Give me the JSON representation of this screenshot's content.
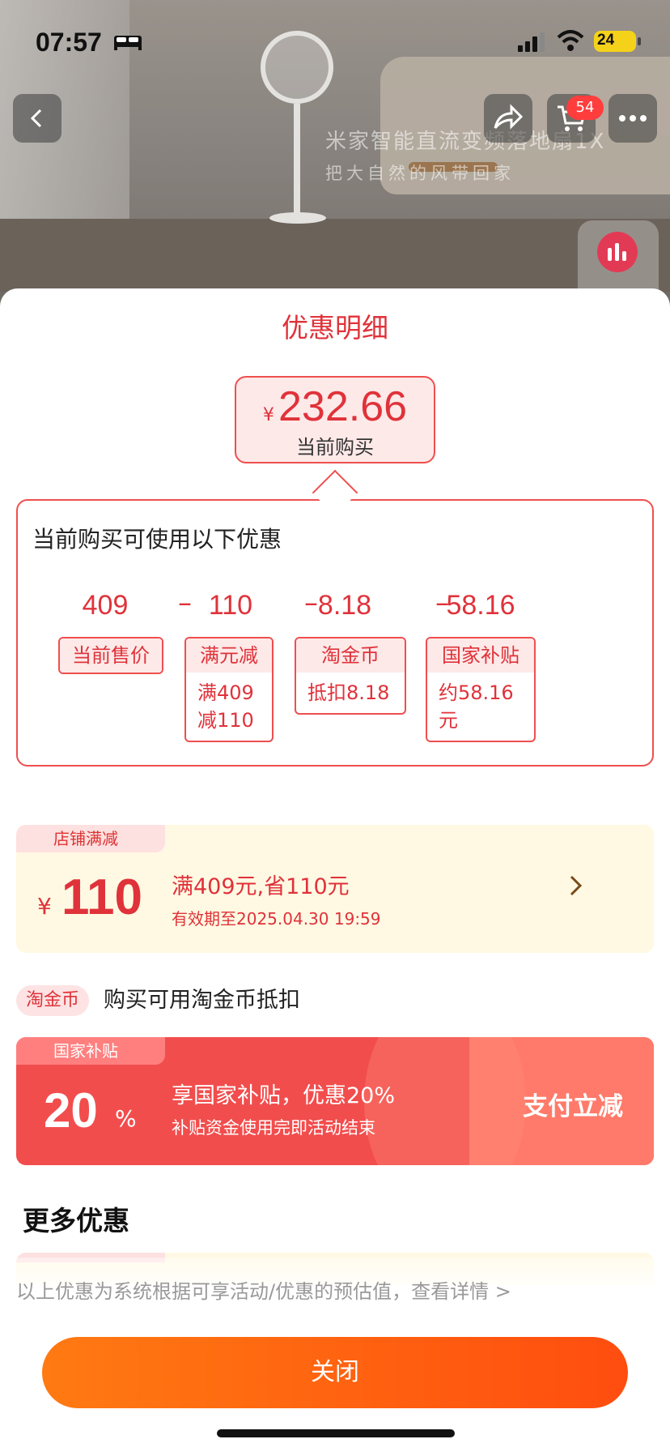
{
  "status_bar": {
    "time": "07:57",
    "battery": "24"
  },
  "product_banner": {
    "title": "米家智能直流变频落地扇1X",
    "subtitle": "把大自然的风带回家"
  },
  "nav": {
    "cart_count": "54"
  },
  "sheet": {
    "title": "优惠明细",
    "current_price": {
      "currency": "¥",
      "amount": "232.66",
      "label": "当前购买"
    },
    "breakdown": {
      "heading": "当前购买可使用以下优惠",
      "operator": "–",
      "items": [
        {
          "value": "409",
          "tag": "当前售价",
          "detail": ""
        },
        {
          "value": "110",
          "tag": "满元减",
          "detail": "满409减110"
        },
        {
          "value": "8.18",
          "tag": "淘金币",
          "detail": "抵扣8.18"
        },
        {
          "value": "58.16",
          "tag": "国家补贴",
          "detail": "约58.16元"
        }
      ]
    },
    "store_coupon": {
      "tag": "店铺满减",
      "currency": "¥",
      "amount": "110",
      "condition": "满409元,省110元",
      "validity": "有效期至2025.04.30 19:59"
    },
    "coin": {
      "pill": "淘金币",
      "text": "购买可用淘金币抵扣"
    },
    "subsidy": {
      "tag": "国家补贴",
      "percent": "20",
      "percent_sign": "%",
      "main": "享国家补贴，优惠20%",
      "sub": "补贴资金使用完即活动结束",
      "action": "支付立减"
    },
    "more_title": "更多优惠",
    "disclaimer": "以上优惠为系统根据可享活动/优惠的预估值，查看详情 >",
    "close_label": "关闭"
  },
  "colors": {
    "accent": "#e0323a",
    "coupon_bg": "#fff9e3",
    "subsidy_bg": "#f24d4d",
    "close_start": "#ff7a12",
    "close_end": "#ff4d0f"
  }
}
